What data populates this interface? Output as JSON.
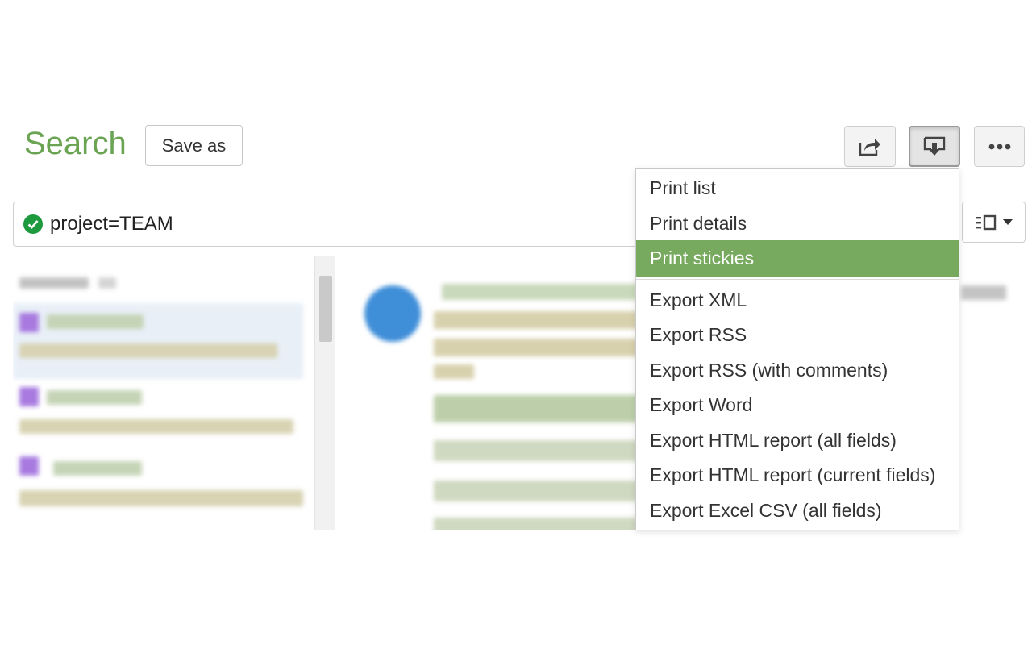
{
  "header": {
    "title": "Search",
    "save_as_label": "Save as"
  },
  "toolbar": {
    "share_icon": "share-icon",
    "export_icon": "export-icon",
    "more_icon": "more-icon"
  },
  "search": {
    "query": "project=TEAM",
    "status_icon": "check-circle-icon",
    "status_color": "#1e9a3e"
  },
  "layout_switcher": {
    "icon": "layout-list-icon",
    "caret_icon": "caret-down-icon"
  },
  "export_menu": {
    "print_items": [
      "Print list",
      "Print details",
      "Print stickies"
    ],
    "highlighted": "Print stickies",
    "export_items": [
      "Export XML",
      "Export RSS",
      "Export RSS (with comments)",
      "Export Word",
      "Export HTML report (all fields)",
      "Export HTML report (current fields)",
      "Export Excel CSV (all fields)"
    ],
    "highlight_color": "#77a95e"
  },
  "colors": {
    "title": "#6aa452",
    "accent": "#77a95e"
  }
}
